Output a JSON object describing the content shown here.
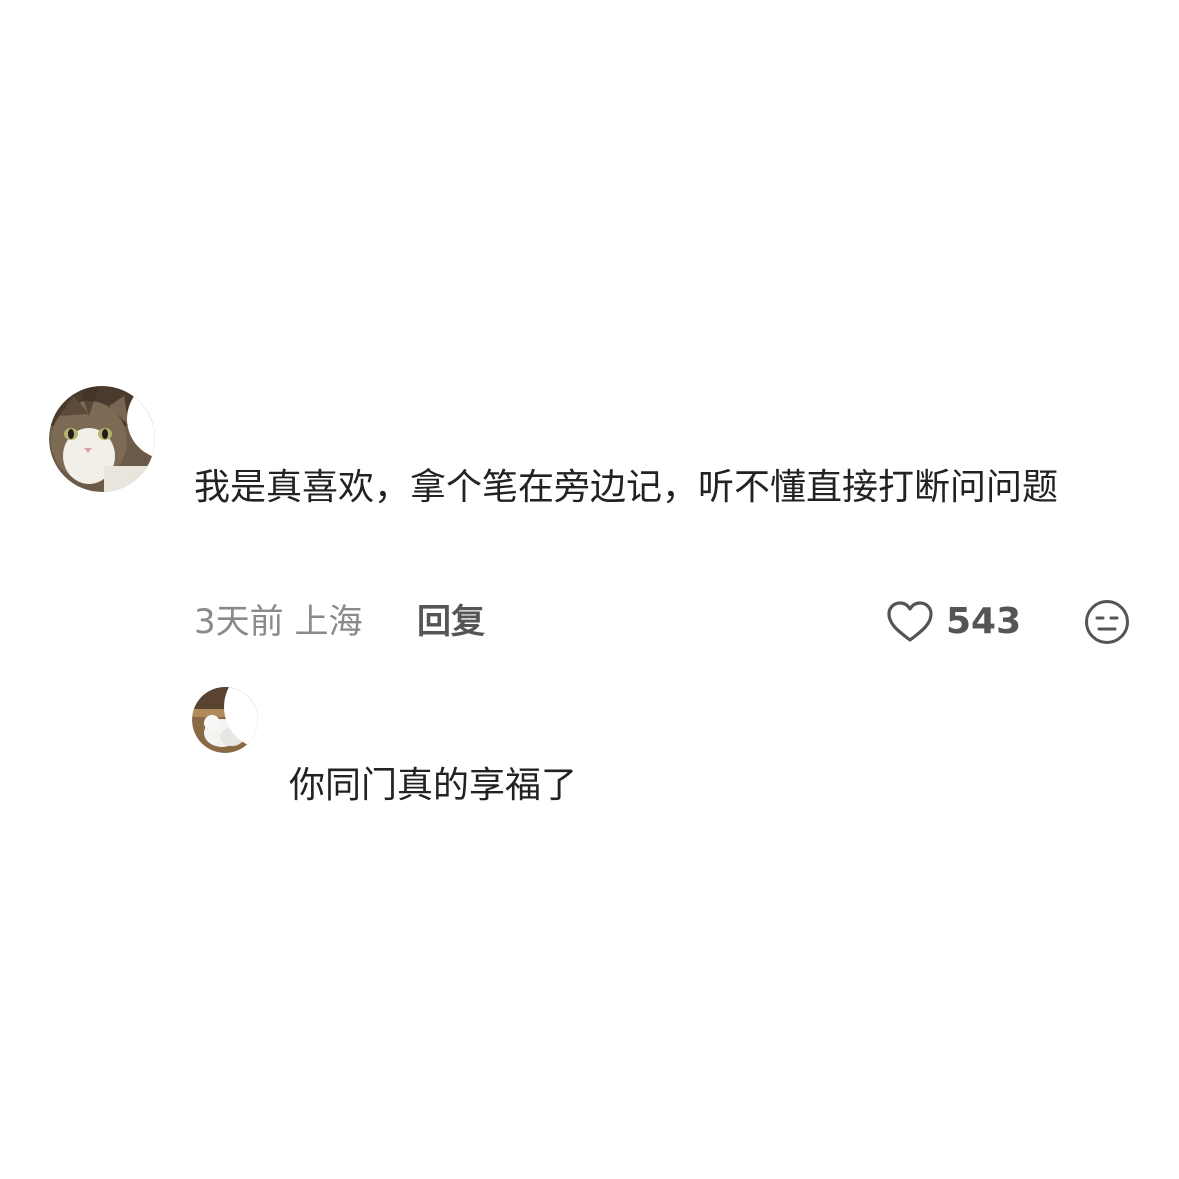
{
  "comment": {
    "avatar_icon": "cat-avatar-icon",
    "text": "我是真喜欢，拿个笔在旁边记，听不懂直接打断问问题",
    "time": "3天前",
    "location": "上海",
    "reply_label": "回复",
    "like_icon": "heart-outline-icon",
    "like_count": "543",
    "emoji_icon": "neutral-face-icon"
  },
  "reply": {
    "avatar_icon": "bird-avatar-icon",
    "text": "你同门真的享福了"
  },
  "colors": {
    "background": "#ffffff",
    "text_primary": "#222222",
    "text_secondary": "#8a8a8a",
    "action_text": "#555555"
  }
}
